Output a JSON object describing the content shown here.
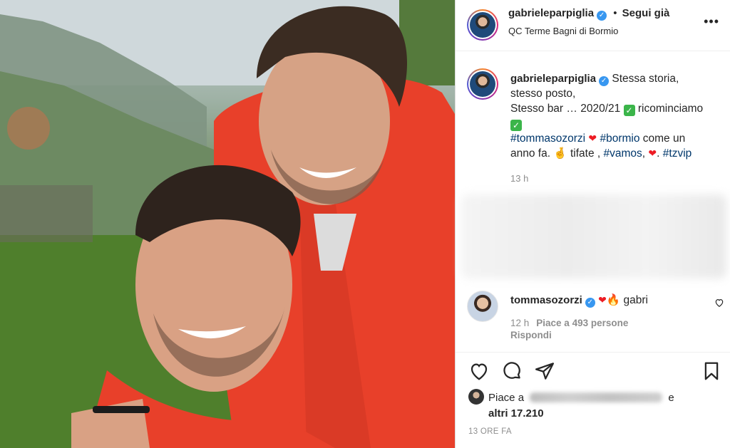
{
  "header": {
    "username": "gabrieleparpiglia",
    "separator": "•",
    "follow_label": "Segui già",
    "location": "QC Terme Bagni di Bormio",
    "more_icon": "more-horizontal-icon"
  },
  "caption": {
    "username": "gabrieleparpiglia",
    "line1": "Stessa storia,",
    "line2": "stesso posto,",
    "line3_text": "Stesso bar … 2020/21",
    "line3_tail": "ricominciamo",
    "tag1": "#tommasozorzi",
    "tag2": "#bormio",
    "mid_text": "come un",
    "line6_text": "anno fa.",
    "line6_tail": "tifate ,",
    "tag3": "#vamos",
    "comma": ",",
    "dot": ".",
    "tag4": "#tzvip",
    "time": "13 h"
  },
  "comment": {
    "username": "tommasozorzi",
    "text": "gabri",
    "time": "12 h",
    "likes": "Piace a 493 persone",
    "reply": "Rispondi"
  },
  "likes": {
    "prefix": "Piace a",
    "conj": "e",
    "total": "altri 17.210"
  },
  "post_time": "13 ORE FA",
  "colors": {
    "link": "#00376b",
    "verified": "#3897f0",
    "muted": "#8e8e8e",
    "photo_hoodie": "#e8402a"
  }
}
